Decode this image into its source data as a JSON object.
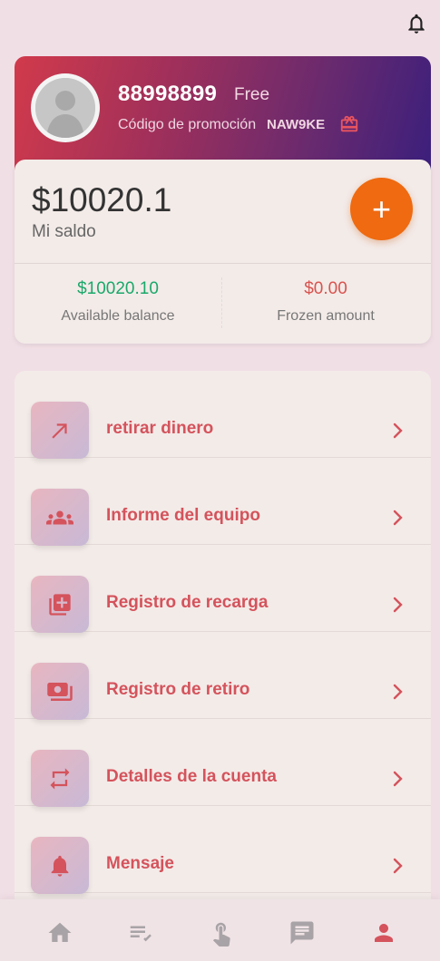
{
  "profile": {
    "uid": "88998899",
    "level": "Free",
    "promo_label": "Código de promoción",
    "promo_code": "NAW9KE"
  },
  "balance": {
    "amount": "$10020.1",
    "label": "Mi saldo",
    "available_value": "$10020.10",
    "available_label": "Available balance",
    "frozen_value": "$0.00",
    "frozen_label": "Frozen amount"
  },
  "menu": {
    "items": [
      {
        "label": "retirar dinero",
        "icon": "arrow-up-right-icon"
      },
      {
        "label": "Informe del equipo",
        "icon": "group-icon"
      },
      {
        "label": "Registro de recarga",
        "icon": "library-add-icon"
      },
      {
        "label": "Registro de retiro",
        "icon": "payments-icon"
      },
      {
        "label": "Detalles de la cuenta",
        "icon": "swap-icon"
      },
      {
        "label": "Mensaje",
        "icon": "bell-icon"
      }
    ]
  },
  "nav": {
    "items": [
      "home-icon",
      "task-list-icon",
      "tap-icon",
      "chat-icon",
      "profile-icon"
    ],
    "active": "profile-icon"
  },
  "colors": {
    "accent": "#d4535c",
    "available": "#1aa86a",
    "frozen": "#d9534f",
    "add_button": "#ef6a10"
  }
}
